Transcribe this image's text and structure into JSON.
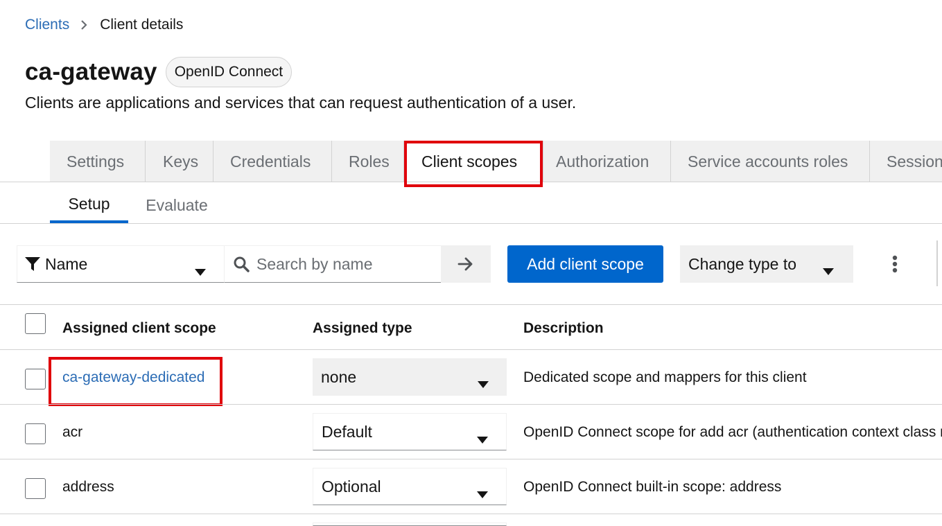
{
  "breadcrumb": {
    "parent": "Clients",
    "current": "Client details"
  },
  "header": {
    "title": "ca-gateway",
    "protocol_badge": "OpenID Connect",
    "description": "Clients are applications and services that can request authentication of a user."
  },
  "tabs": [
    {
      "label": "Settings"
    },
    {
      "label": "Keys"
    },
    {
      "label": "Credentials"
    },
    {
      "label": "Roles"
    },
    {
      "label": "Client scopes"
    },
    {
      "label": "Authorization"
    },
    {
      "label": "Service accounts roles"
    },
    {
      "label": "Sessions"
    }
  ],
  "subtabs": [
    {
      "label": "Setup"
    },
    {
      "label": "Evaluate"
    }
  ],
  "toolbar": {
    "filter_label": "Name",
    "search_placeholder": "Search by name",
    "add_button": "Add client scope",
    "change_type": "Change type to"
  },
  "table": {
    "headers": [
      "Assigned client scope",
      "Assigned type",
      "Description"
    ],
    "rows": [
      {
        "name": "ca-gateway-dedicated",
        "type": "none",
        "description": "Dedicated scope and mappers for this client"
      },
      {
        "name": "acr",
        "type": "Default",
        "description": "OpenID Connect scope for add acr (authentication context class reference) to the token"
      },
      {
        "name": "address",
        "type": "Optional",
        "description": "OpenID Connect built-in scope: address"
      }
    ]
  },
  "colors": {
    "accent": "#0066cc",
    "link": "#2b6cb5",
    "highlight": "#e0000b"
  }
}
